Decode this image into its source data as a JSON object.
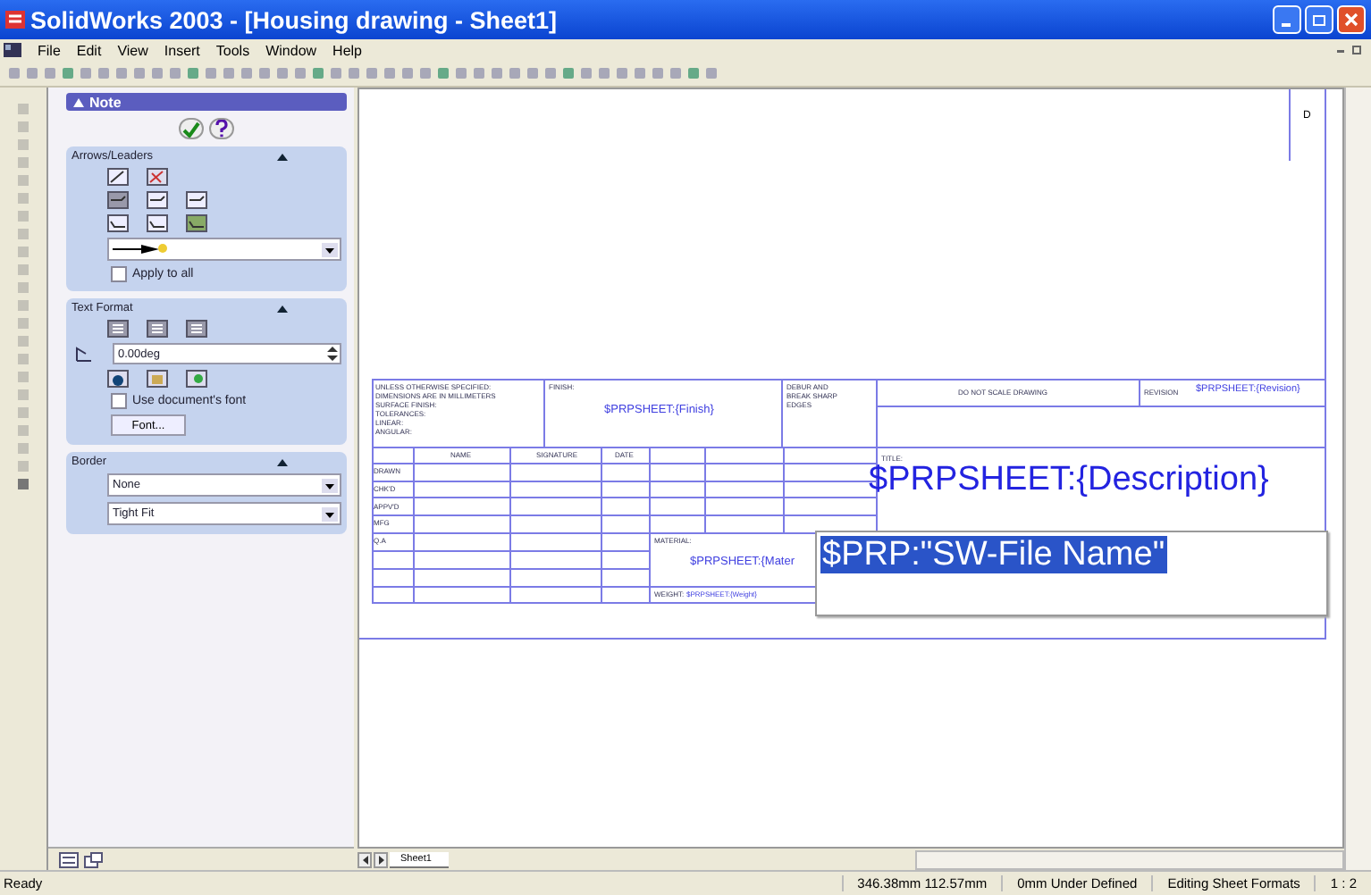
{
  "window": {
    "title": "SolidWorks 2003 - [Housing drawing - Sheet1]"
  },
  "menu": [
    "File",
    "Edit",
    "View",
    "Insert",
    "Tools",
    "Window",
    "Help"
  ],
  "property_manager": {
    "title": "Note",
    "groups": [
      {
        "kind": "leaders",
        "title": "Arrows/Leaders",
        "expanded": true,
        "checkbox": {
          "label": "Apply to all",
          "checked": false
        }
      },
      {
        "kind": "text",
        "title": "Text Format",
        "expanded": true,
        "angle": "0.00deg",
        "checkbox": {
          "label": "Use document's font",
          "checked": false
        },
        "button": "Font..."
      },
      {
        "kind": "border",
        "title": "Border",
        "expanded": true,
        "dropdowns": [
          "None",
          "Tight Fit"
        ]
      }
    ]
  },
  "sheet": {
    "zone": "D",
    "title_block": {
      "notes": [
        "UNLESS OTHERWISE SPECIFIED:",
        "DIMENSIONS ARE IN MILLIMETERS",
        "SURFACE FINISH:",
        "TOLERANCES:",
        "LINEAR:",
        "ANGULAR:"
      ],
      "finish_label": "FINISH:",
      "finish": "$PRPSHEET:{Finish}",
      "deburr": [
        "DEBUR AND",
        "BREAK SHARP",
        "EDGES"
      ],
      "no_scale": "DO NOT SCALE DRAWING",
      "revision_label": "REVISION",
      "revision": "$PRPSHEET:{Revision}",
      "title_label": "TITLE:",
      "description": "$PRPSHEET:{Description}",
      "columns": [
        "NAME",
        "SIGNATURE",
        "DATE"
      ],
      "roles": [
        "DRAWN",
        "CHK'D",
        "APPV'D",
        "MFG",
        "Q.A"
      ],
      "material_label": "MATERIAL:",
      "material": "$PRPSHEET:{Mater",
      "weight_label": "WEIGHT:",
      "weight": "$PRPSHEET:{Weight}"
    },
    "note": {
      "text": "$PRP:\"SW-File Name\"",
      "selected": true
    }
  },
  "sheet_tabs": [
    {
      "label": "Sheet1",
      "selected": true
    }
  ],
  "status_bar": {
    "message": "Ready",
    "fields": [
      "346.38mm 112.57mm",
      "0mm Under Defined",
      "Editing Sheet Formats",
      "1 : 2"
    ]
  }
}
